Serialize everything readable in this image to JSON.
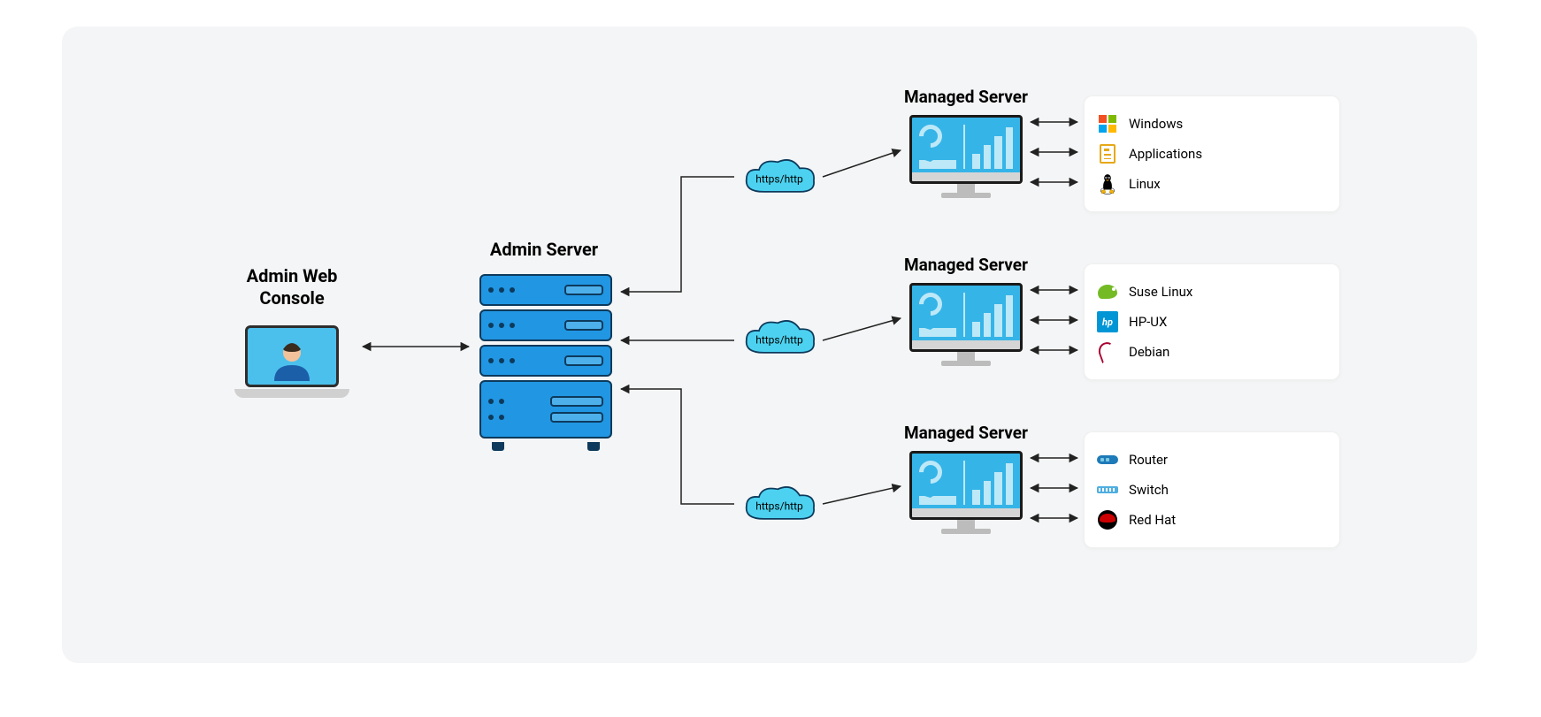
{
  "nodes": {
    "admin_console": {
      "title_line1": "Admin Web",
      "title_line2": "Console"
    },
    "admin_server": {
      "title": "Admin Server"
    },
    "managed_server": {
      "title": "Managed Server"
    }
  },
  "protocol_label": "https/http",
  "cards": [
    {
      "items": [
        {
          "icon": "windows",
          "label": "Windows"
        },
        {
          "icon": "applications",
          "label": "Applications"
        },
        {
          "icon": "linux",
          "label": "Linux"
        }
      ]
    },
    {
      "items": [
        {
          "icon": "suse",
          "label": "Suse Linux"
        },
        {
          "icon": "hpux",
          "label": "HP-UX"
        },
        {
          "icon": "debian",
          "label": "Debian"
        }
      ]
    },
    {
      "items": [
        {
          "icon": "router",
          "label": "Router"
        },
        {
          "icon": "switch",
          "label": "Switch"
        },
        {
          "icon": "redhat",
          "label": "Red Hat"
        }
      ]
    }
  ],
  "colors": {
    "panel": "#f4f5f6",
    "server_blue": "#2196e3",
    "screen_blue": "#35b4e8",
    "cloud_fill": "#4cd2f0"
  }
}
